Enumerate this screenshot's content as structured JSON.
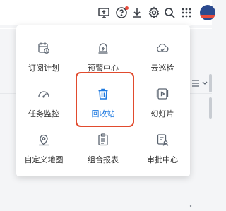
{
  "colors": {
    "accent": "#1f7ae0",
    "highlight": "#e14b2e",
    "icon": "#5b6470",
    "badge": "#e84c3d"
  },
  "topbar": {
    "icons": [
      "screen-share-icon",
      "help-circle-icon",
      "download-icon",
      "settings-icon",
      "search-icon",
      "apps-grid-icon",
      "user-avatar"
    ]
  },
  "apps_menu": {
    "items": [
      {
        "label": "订阅计划",
        "icon": "calendar-clock-icon"
      },
      {
        "label": "预警中心",
        "icon": "alarm-bell-icon"
      },
      {
        "label": "云巡检",
        "icon": "cloud-check-icon"
      },
      {
        "label": "任务监控",
        "icon": "gauge-icon"
      },
      {
        "label": "回收站",
        "icon": "trash-icon",
        "active": true
      },
      {
        "label": "幻灯片",
        "icon": "slideshow-icon"
      },
      {
        "label": "自定义地图",
        "icon": "map-pin-icon"
      },
      {
        "label": "组合报表",
        "icon": "clipboard-icon"
      },
      {
        "label": "审批中心",
        "icon": "approval-icon"
      }
    ]
  }
}
